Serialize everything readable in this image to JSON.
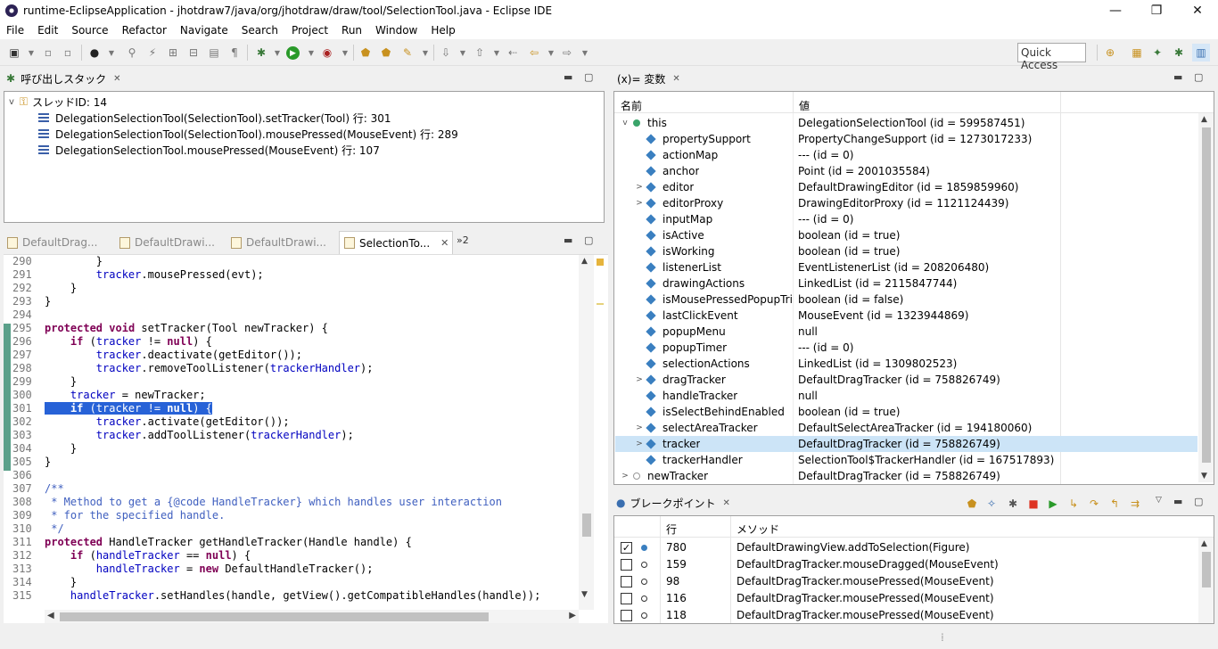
{
  "window": {
    "title": "runtime-EclipseApplication - jhotdraw7/java/org/jhotdraw/draw/tool/SelectionTool.java - Eclipse IDE",
    "minimize": "—",
    "maximize": "❐",
    "close": "✕"
  },
  "menu": [
    "File",
    "Edit",
    "Source",
    "Refactor",
    "Navigate",
    "Search",
    "Project",
    "Run",
    "Window",
    "Help"
  ],
  "toolbar": {
    "quick_access": "Quick Access"
  },
  "call_stack": {
    "tab_label": "呼び出しスタック",
    "thread": "スレッドID: 14",
    "frames": [
      "DelegationSelectionTool(SelectionTool).setTracker(Tool) 行: 301",
      "DelegationSelectionTool(SelectionTool).mousePressed(MouseEvent) 行: 289",
      "DelegationSelectionTool.mousePressed(MouseEvent) 行: 107"
    ]
  },
  "editor": {
    "tabs": [
      "DefaultDrag...",
      "DefaultDrawi...",
      "DefaultDrawi...",
      "SelectionTo..."
    ],
    "active_tab": 3,
    "overflow": "»2",
    "lines": [
      {
        "n": "290",
        "t": "        }"
      },
      {
        "n": "291",
        "t": "        tracker.mousePressed(evt);"
      },
      {
        "n": "292",
        "t": "    }"
      },
      {
        "n": "293",
        "t": "}"
      },
      {
        "n": "294",
        "t": ""
      },
      {
        "n": "295",
        "t": "protected void setTracker(Tool newTracker) {"
      },
      {
        "n": "296",
        "t": "    if (tracker != null) {"
      },
      {
        "n": "297",
        "t": "        tracker.deactivate(getEditor());"
      },
      {
        "n": "298",
        "t": "        tracker.removeToolListener(trackerHandler);"
      },
      {
        "n": "299",
        "t": "    }"
      },
      {
        "n": "300",
        "t": "    tracker = newTracker;"
      },
      {
        "n": "301",
        "t": "    if (tracker != null) {"
      },
      {
        "n": "302",
        "t": "        tracker.activate(getEditor());"
      },
      {
        "n": "303",
        "t": "        tracker.addToolListener(trackerHandler);"
      },
      {
        "n": "304",
        "t": "    }"
      },
      {
        "n": "305",
        "t": "}"
      },
      {
        "n": "306",
        "t": ""
      },
      {
        "n": "307",
        "t": "/**"
      },
      {
        "n": "308",
        "t": " * Method to get a {@code HandleTracker} which handles user interaction"
      },
      {
        "n": "309",
        "t": " * for the specified handle."
      },
      {
        "n": "310",
        "t": " */"
      },
      {
        "n": "311",
        "t": "protected HandleTracker getHandleTracker(Handle handle) {"
      },
      {
        "n": "312",
        "t": "    if (handleTracker == null) {"
      },
      {
        "n": "313",
        "t": "        handleTracker = new DefaultHandleTracker();"
      },
      {
        "n": "314",
        "t": "    }"
      },
      {
        "n": "315",
        "t": "    handleTracker.setHandles(handle, getView().getCompatibleHandles(handle));"
      }
    ]
  },
  "variables": {
    "tab_label": "(x)= 変数",
    "col_name": "名前",
    "col_value": "値",
    "rows": [
      {
        "name": "this",
        "value": "DelegationSelectionTool (id = 599587451)",
        "depth": 0,
        "expand": "v"
      },
      {
        "name": "propertySupport",
        "value": "PropertyChangeSupport (id = 1273017233)",
        "depth": 1,
        "expand": ""
      },
      {
        "name": "actionMap",
        "value": "--- (id = 0)",
        "depth": 1,
        "expand": ""
      },
      {
        "name": "anchor",
        "value": "Point (id = 2001035584)",
        "depth": 1,
        "expand": ""
      },
      {
        "name": "editor",
        "value": "DefaultDrawingEditor (id = 1859859960)",
        "depth": 1,
        "expand": ">"
      },
      {
        "name": "editorProxy",
        "value": "DrawingEditorProxy (id = 1121124439)",
        "depth": 1,
        "expand": ">"
      },
      {
        "name": "inputMap",
        "value": "--- (id = 0)",
        "depth": 1,
        "expand": ""
      },
      {
        "name": "isActive",
        "value": "boolean (id = true)",
        "depth": 1,
        "expand": ""
      },
      {
        "name": "isWorking",
        "value": "boolean (id = true)",
        "depth": 1,
        "expand": ""
      },
      {
        "name": "listenerList",
        "value": "EventListenerList (id = 208206480)",
        "depth": 1,
        "expand": ""
      },
      {
        "name": "drawingActions",
        "value": "LinkedList (id = 2115847744)",
        "depth": 1,
        "expand": ""
      },
      {
        "name": "isMousePressedPopupTrigg",
        "value": "boolean (id = false)",
        "depth": 1,
        "expand": ""
      },
      {
        "name": "lastClickEvent",
        "value": "MouseEvent (id = 1323944869)",
        "depth": 1,
        "expand": ""
      },
      {
        "name": "popupMenu",
        "value": "null",
        "depth": 1,
        "expand": ""
      },
      {
        "name": "popupTimer",
        "value": "--- (id = 0)",
        "depth": 1,
        "expand": ""
      },
      {
        "name": "selectionActions",
        "value": "LinkedList (id = 1309802523)",
        "depth": 1,
        "expand": ""
      },
      {
        "name": "dragTracker",
        "value": "DefaultDragTracker (id = 758826749)",
        "depth": 1,
        "expand": ">"
      },
      {
        "name": "handleTracker",
        "value": "null",
        "depth": 1,
        "expand": ""
      },
      {
        "name": "isSelectBehindEnabled",
        "value": "boolean (id = true)",
        "depth": 1,
        "expand": ""
      },
      {
        "name": "selectAreaTracker",
        "value": "DefaultSelectAreaTracker (id = 194180060)",
        "depth": 1,
        "expand": ">"
      },
      {
        "name": "tracker",
        "value": "DefaultDragTracker (id = 758826749)",
        "depth": 1,
        "expand": ">",
        "selected": true
      },
      {
        "name": "trackerHandler",
        "value": "SelectionTool$TrackerHandler (id = 167517893)",
        "depth": 1,
        "expand": ""
      },
      {
        "name": "newTracker",
        "value": "DefaultDragTracker (id = 758826749)",
        "depth": 0,
        "expand": ">"
      }
    ]
  },
  "breakpoints": {
    "tab_label": "ブレークポイント",
    "col_line": "行",
    "col_method": "メソッド",
    "rows": [
      {
        "checked": true,
        "line": "780",
        "method": "DefaultDrawingView.addToSelection(Figure)"
      },
      {
        "checked": false,
        "line": "159",
        "method": "DefaultDragTracker.mouseDragged(MouseEvent)"
      },
      {
        "checked": false,
        "line": "98",
        "method": "DefaultDragTracker.mousePressed(MouseEvent)"
      },
      {
        "checked": false,
        "line": "116",
        "method": "DefaultDragTracker.mousePressed(MouseEvent)"
      },
      {
        "checked": false,
        "line": "118",
        "method": "DefaultDragTracker.mousePressed(MouseEvent)"
      }
    ]
  }
}
